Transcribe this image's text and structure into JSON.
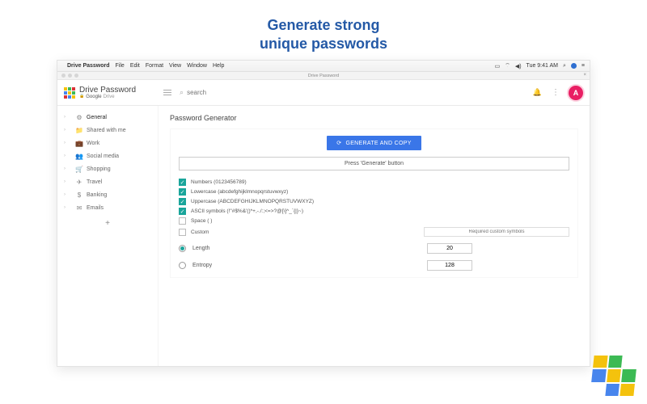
{
  "headline": {
    "line1": "Generate strong",
    "line2": "unique passwords"
  },
  "menubar": {
    "apple": "",
    "app": "Drive Password",
    "items": [
      "File",
      "Edit",
      "Format",
      "View",
      "Window",
      "Help"
    ],
    "time": "Tue 9:41 AM"
  },
  "titlebar": {
    "title": "Drive Password"
  },
  "header": {
    "brand_title": "Drive Password",
    "brand_sub_service": "Google",
    "brand_sub_product": "Drive",
    "search_placeholder": "search",
    "avatar_initial": "A"
  },
  "sidebar": {
    "items": [
      {
        "icon": "⚙",
        "label": "General"
      },
      {
        "icon": "📁",
        "label": "Shared with me"
      },
      {
        "icon": "💼",
        "label": "Work"
      },
      {
        "icon": "👥",
        "label": "Social media"
      },
      {
        "icon": "🛒",
        "label": "Shopping"
      },
      {
        "icon": "✈",
        "label": "Travel"
      },
      {
        "icon": "$",
        "label": "Banking"
      },
      {
        "icon": "✉",
        "label": "Emails"
      }
    ],
    "add": "+"
  },
  "main": {
    "title": "Password Generator",
    "generate_button": "GENERATE AND COPY",
    "result_text": "Press 'Generate' button",
    "options": [
      {
        "checked": true,
        "label": "Numbers (0123456789)"
      },
      {
        "checked": true,
        "label": "Lowercase (abcdefghijklmnopqrstuvwxyz)"
      },
      {
        "checked": true,
        "label": "Uppercase (ABCDEFGHIJKLMNOPQRSTUVWXYZ)"
      },
      {
        "checked": true,
        "label": "ASCII symbols (!\"#$%&'()*+,-./:;<=>?@[\\]^_`{|}~)"
      },
      {
        "checked": false,
        "label": "Space ( )"
      },
      {
        "checked": false,
        "label": "Custom",
        "has_input": true,
        "input_placeholder": "Required custom symbols"
      }
    ],
    "radios": [
      {
        "selected": true,
        "label": "Length",
        "value": "20"
      },
      {
        "selected": false,
        "label": "Entropy",
        "value": "128"
      }
    ]
  }
}
